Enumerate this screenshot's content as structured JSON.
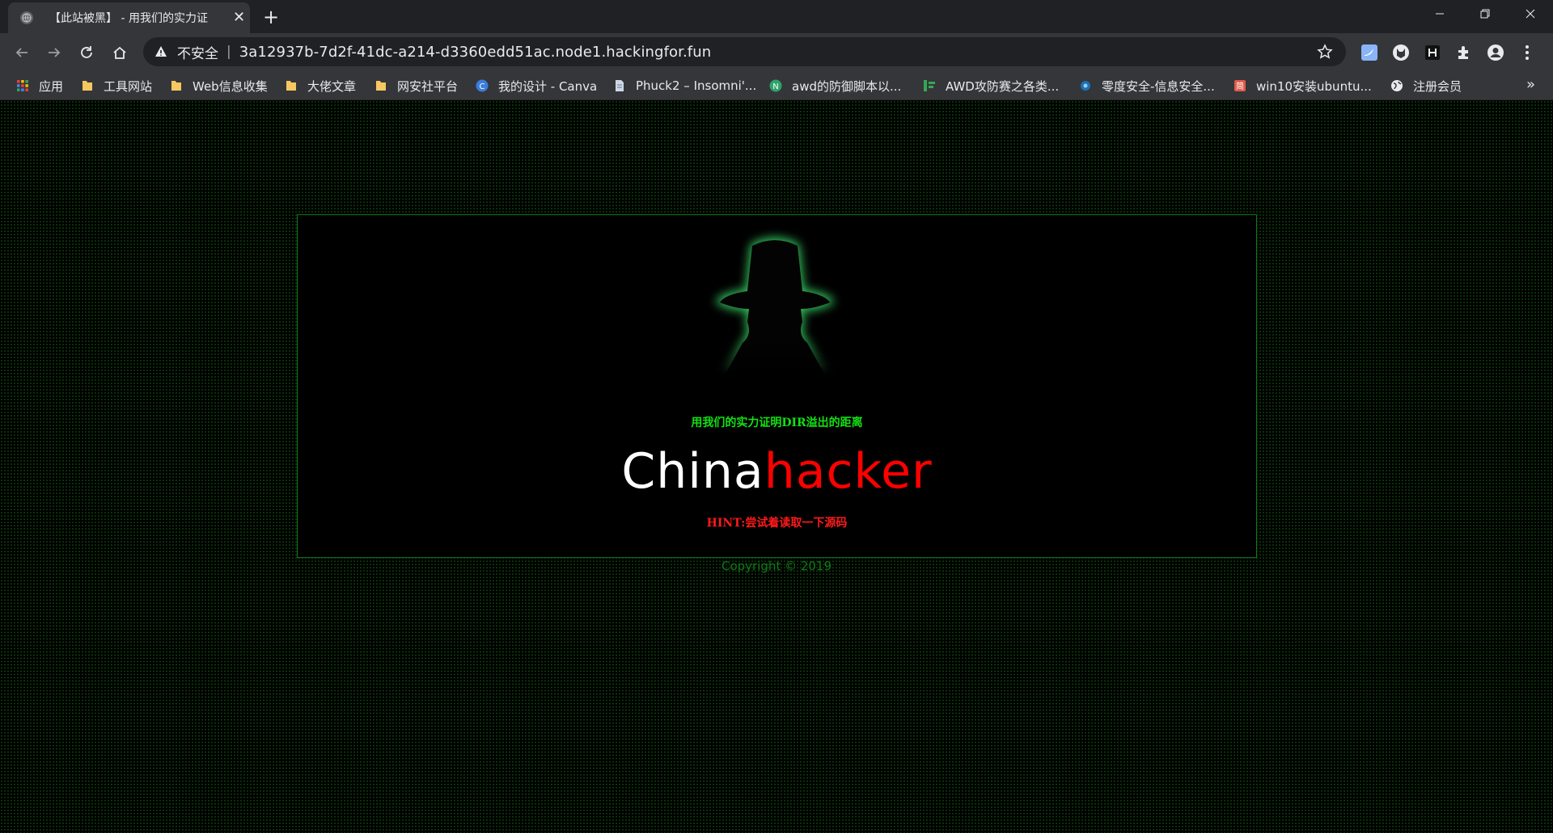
{
  "browser": {
    "tab": {
      "title": "【此站被黑】 - 用我们的实力证",
      "favicon": "globe-icon"
    },
    "address_bar": {
      "security_label": "不安全",
      "separator": "|",
      "url": "3a12937b-7d2f-41dc-a214-d3360edd51ac.node1.hackingfor.fun"
    },
    "bookmarks": [
      {
        "label": "应用",
        "icon": "apps-grid-icon"
      },
      {
        "label": "工具网站",
        "icon": "folder-icon"
      },
      {
        "label": "Web信息收集",
        "icon": "folder-icon"
      },
      {
        "label": "大佬文章",
        "icon": "folder-icon"
      },
      {
        "label": "网安社平台",
        "icon": "folder-icon"
      },
      {
        "label": "我的设计 - Canva",
        "icon": "canva-icon"
      },
      {
        "label": "Phuck2 – Insomni'...",
        "icon": "page-icon"
      },
      {
        "label": "awd的防御脚本以...",
        "icon": "n-circle-icon"
      },
      {
        "label": "AWD攻防赛之各类...",
        "icon": "green-bars-icon"
      },
      {
        "label": "零度安全-信息安全...",
        "icon": "gear-site-icon"
      },
      {
        "label": "win10安装ubuntu...",
        "icon": "jian-icon"
      },
      {
        "label": "注册会员",
        "icon": "globe-icon"
      }
    ],
    "bookmarks_overflow": "»"
  },
  "page": {
    "headline": "用我们的实力证明DIR溢出的距离",
    "brand_white": "China",
    "brand_red": "hacker",
    "hint": "HINT:尝试着读取一下源码",
    "copyright": "Copyright © 2019"
  },
  "colors": {
    "border": "#0d7a17",
    "headline": "#12e012",
    "brand_red": "#ff0000",
    "hint": "#ff1a1a",
    "copyright": "#0e7a18"
  }
}
